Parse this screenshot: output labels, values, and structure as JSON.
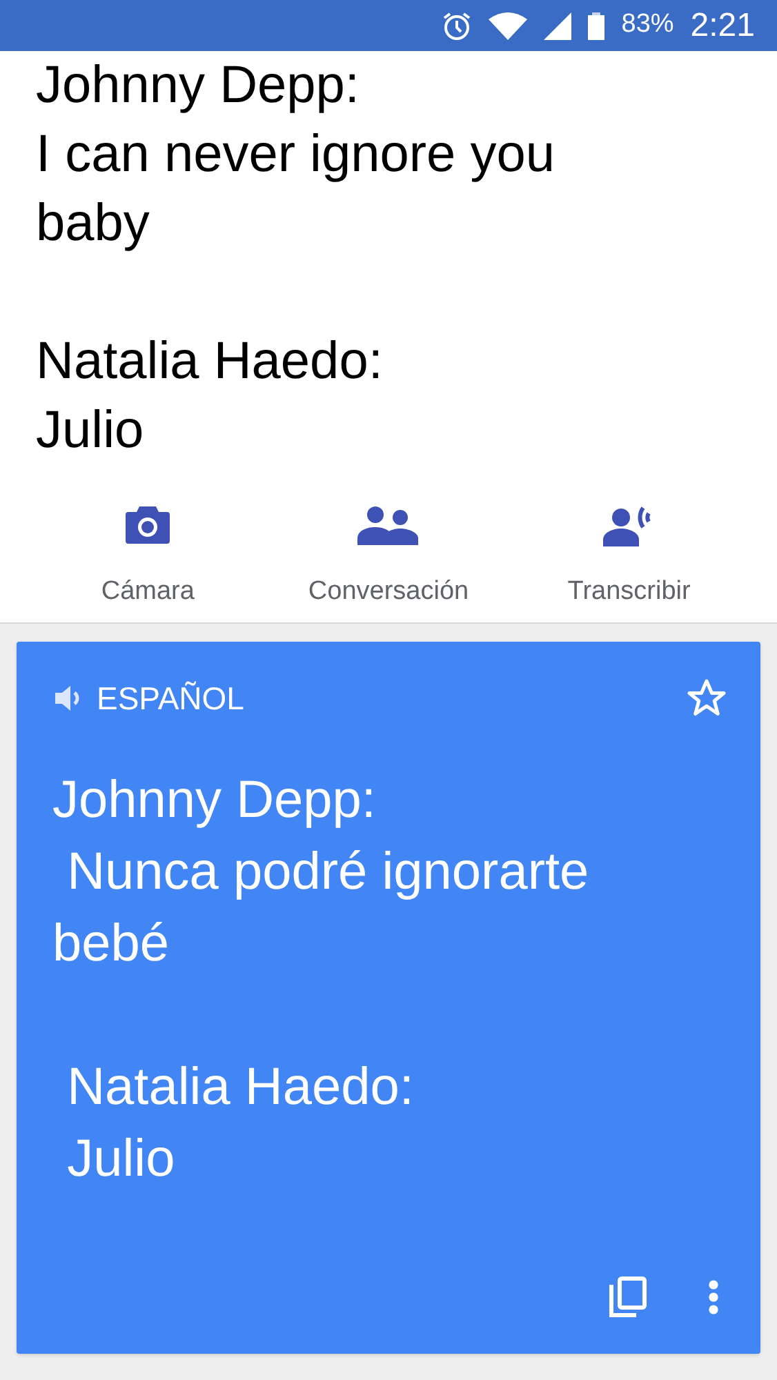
{
  "status_bar": {
    "battery": "83%",
    "time": "2:21"
  },
  "source": {
    "paragraphs": [
      [
        "Johnny Depp:",
        "I can never ignore you baby"
      ],
      [
        "Natalia Haedo:",
        "Julio"
      ]
    ]
  },
  "actions": [
    {
      "kind": "camera",
      "label": "Cámara"
    },
    {
      "kind": "conversation",
      "label": "Conversación"
    },
    {
      "kind": "transcribe",
      "label": "Transcribir"
    }
  ],
  "translation": {
    "language": "ESPAÑOL",
    "starred": false,
    "paragraphs": [
      [
        "Johnny Depp:",
        " Nunca podré ignorarte bebé"
      ],
      [
        " Natalia Haedo:",
        " Julio"
      ]
    ]
  }
}
